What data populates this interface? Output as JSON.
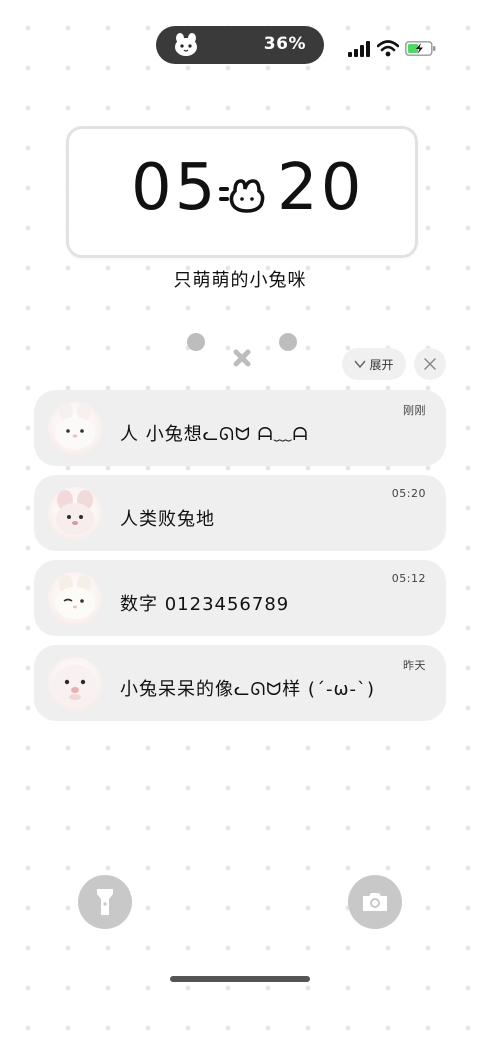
{
  "status_bar": {
    "battery_percent": "36%",
    "pill_icon": "bunny-face-icon",
    "icons": [
      "signal-bars-icon",
      "wifi-icon",
      "battery-charging-icon"
    ],
    "battery_color": "#4cd964"
  },
  "lock_screen": {
    "time_hours": "05",
    "time_minutes": "20",
    "time_separator_icon": "bunny-face-icon",
    "tagline": "只萌萌的小兔咪"
  },
  "notification_controls": {
    "expand_label": "展开",
    "expand_icon": "chevron-down-icon",
    "close_icon": "close-icon"
  },
  "notifications": [
    {
      "avatar": "white-bunny-photo",
      "text": "人 小兔想ᓚᘏᗢ ᗩ﹏ᗩ",
      "time": "刚刚"
    },
    {
      "avatar": "pink-bunny-photo",
      "text": "人类败兔地",
      "time": "05:20"
    },
    {
      "avatar": "winking-bunny-photo",
      "text": "数字 0123456789",
      "time": "05:12"
    },
    {
      "avatar": "bunny-face-photo",
      "text": "小兔呆呆的像ᓚᘏᗢ样 (´-ω-`)",
      "time": "昨天"
    }
  ],
  "quick_actions": {
    "left_icon": "flashlight-icon",
    "right_icon": "camera-icon"
  }
}
